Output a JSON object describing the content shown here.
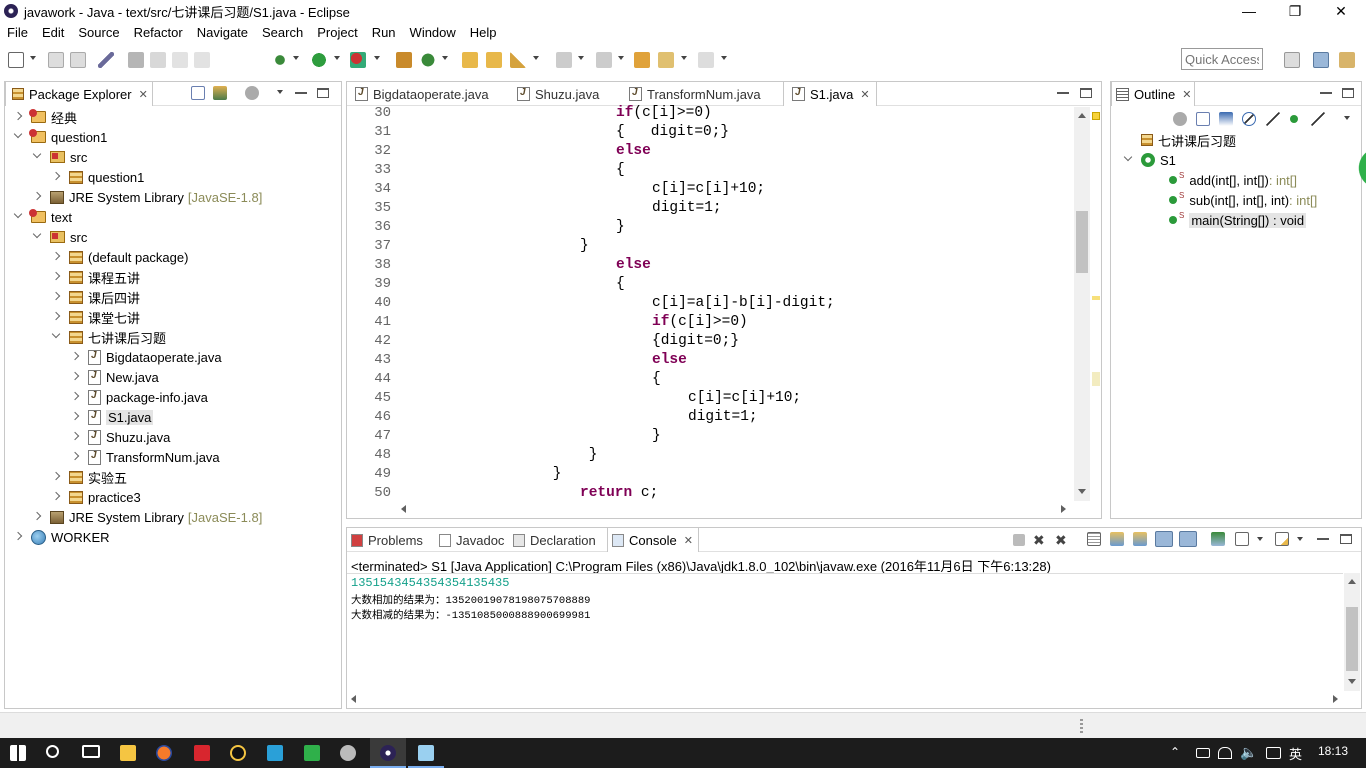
{
  "window": {
    "title": "javawork - Java - text/src/七讲课后习题/S1.java - Eclipse",
    "minimize_icon": "minimize-icon",
    "maximize_icon": "restore-icon",
    "close_icon": "close-icon"
  },
  "menu": [
    "File",
    "Edit",
    "Source",
    "Refactor",
    "Navigate",
    "Search",
    "Project",
    "Run",
    "Window",
    "Help"
  ],
  "toolbar": {
    "quick_access_placeholder": "Quick Access"
  },
  "package_explorer": {
    "tab_label": "Package Explorer",
    "tree": [
      {
        "label": "经典",
        "type": "proj",
        "expanded": false,
        "depth": 0
      },
      {
        "label": "question1",
        "type": "proj",
        "expanded": true,
        "depth": 0
      },
      {
        "label": "src",
        "type": "src",
        "expanded": true,
        "depth": 1
      },
      {
        "label": "question1",
        "type": "pkg",
        "expanded": false,
        "depth": 2
      },
      {
        "label": "JRE System Library",
        "suffix": "[JavaSE-1.8]",
        "type": "lib",
        "expanded": false,
        "depth": 1
      },
      {
        "label": "text",
        "type": "proj",
        "expanded": true,
        "depth": 0
      },
      {
        "label": "src",
        "type": "src",
        "expanded": true,
        "depth": 1
      },
      {
        "label": "(default package)",
        "type": "pkg",
        "expanded": false,
        "depth": 2
      },
      {
        "label": "课程五讲",
        "type": "pkg",
        "expanded": false,
        "depth": 2
      },
      {
        "label": "课后四讲",
        "type": "pkg",
        "expanded": false,
        "depth": 2
      },
      {
        "label": "课堂七讲",
        "type": "pkg",
        "expanded": false,
        "depth": 2
      },
      {
        "label": "七讲课后习题",
        "type": "pkg",
        "expanded": true,
        "depth": 2
      },
      {
        "label": "Bigdataoperate.java",
        "type": "java",
        "expanded": false,
        "depth": 3
      },
      {
        "label": "New.java",
        "type": "java",
        "expanded": false,
        "depth": 3
      },
      {
        "label": "package-info.java",
        "type": "java",
        "expanded": false,
        "depth": 3
      },
      {
        "label": "S1.java",
        "type": "java",
        "expanded": false,
        "depth": 3,
        "selected": true
      },
      {
        "label": "Shuzu.java",
        "type": "java",
        "expanded": false,
        "depth": 3
      },
      {
        "label": "TransformNum.java",
        "type": "java",
        "expanded": false,
        "depth": 3
      },
      {
        "label": "实验五",
        "type": "pkg",
        "expanded": false,
        "depth": 2
      },
      {
        "label": "practice3",
        "type": "pkg",
        "expanded": false,
        "depth": 2
      },
      {
        "label": "JRE System Library",
        "suffix": "[JavaSE-1.8]",
        "type": "lib",
        "expanded": false,
        "depth": 1
      },
      {
        "label": "WORKER",
        "type": "world",
        "expanded": false,
        "depth": 0
      }
    ]
  },
  "editor": {
    "tabs": [
      {
        "label": "Bigdataoperate.java",
        "active": false
      },
      {
        "label": "Shuzu.java",
        "active": false
      },
      {
        "label": "TransformNum.java",
        "active": false
      },
      {
        "label": "S1.java",
        "active": true
      }
    ],
    "lines": [
      {
        "n": "30",
        "indent": 24,
        "tokens": [
          {
            "t": "if",
            "k": true
          },
          {
            "t": "(c[i]>=0)"
          }
        ]
      },
      {
        "n": "31",
        "indent": 24,
        "tokens": [
          {
            "t": "{   digit=0;}"
          }
        ]
      },
      {
        "n": "32",
        "indent": 24,
        "tokens": [
          {
            "t": "else",
            "k": true
          }
        ]
      },
      {
        "n": "33",
        "indent": 24,
        "tokens": [
          {
            "t": "{"
          }
        ]
      },
      {
        "n": "34",
        "indent": 28,
        "tokens": [
          {
            "t": "c[i]=c[i]+10;"
          }
        ]
      },
      {
        "n": "35",
        "indent": 28,
        "tokens": [
          {
            "t": "digit=1;"
          }
        ]
      },
      {
        "n": "36",
        "indent": 24,
        "tokens": [
          {
            "t": "}"
          }
        ]
      },
      {
        "n": "37",
        "indent": 20,
        "tokens": [
          {
            "t": "}"
          }
        ]
      },
      {
        "n": "38",
        "indent": 24,
        "tokens": [
          {
            "t": "else",
            "k": true
          }
        ]
      },
      {
        "n": "39",
        "indent": 24,
        "tokens": [
          {
            "t": "{"
          }
        ]
      },
      {
        "n": "40",
        "indent": 28,
        "tokens": [
          {
            "t": "c[i]=a[i]-b[i]-digit;"
          }
        ]
      },
      {
        "n": "41",
        "indent": 28,
        "tokens": [
          {
            "t": "if",
            "k": true
          },
          {
            "t": "(c[i]>=0)"
          }
        ]
      },
      {
        "n": "42",
        "indent": 28,
        "tokens": [
          {
            "t": "{digit=0;}"
          }
        ]
      },
      {
        "n": "43",
        "indent": 28,
        "tokens": [
          {
            "t": "else",
            "k": true
          }
        ]
      },
      {
        "n": "44",
        "indent": 28,
        "tokens": [
          {
            "t": "{"
          }
        ]
      },
      {
        "n": "45",
        "indent": 32,
        "tokens": [
          {
            "t": "c[i]=c[i]+10;"
          }
        ]
      },
      {
        "n": "46",
        "indent": 32,
        "tokens": [
          {
            "t": "digit=1;"
          }
        ]
      },
      {
        "n": "47",
        "indent": 28,
        "tokens": [
          {
            "t": "}"
          }
        ]
      },
      {
        "n": "48",
        "indent": 20,
        "tokens": [
          {
            "t": " }"
          }
        ]
      },
      {
        "n": "49",
        "indent": 16,
        "tokens": [
          {
            "t": " }"
          }
        ]
      },
      {
        "n": "50",
        "indent": 20,
        "tokens": [
          {
            "t": "return",
            "k": true
          },
          {
            "t": " c;"
          }
        ]
      }
    ]
  },
  "outline": {
    "tab_label": "Outline",
    "items": [
      {
        "label": "七讲课后习题",
        "type": "pkg",
        "depth": 0
      },
      {
        "label": "S1",
        "type": "class",
        "depth": 0,
        "expanded": true
      },
      {
        "label": "add(int[], int[])",
        "ret": " : int[]",
        "type": "method",
        "depth": 1
      },
      {
        "label": "sub(int[], int[], int)",
        "ret": " : int[]",
        "type": "method",
        "depth": 1
      },
      {
        "label": "main(String[]) : void",
        "ret": "",
        "type": "main",
        "depth": 1,
        "selected": true
      }
    ]
  },
  "bottom": {
    "tabs": [
      {
        "label": "Problems",
        "active": false
      },
      {
        "label": "Javadoc",
        "active": false
      },
      {
        "label": "Declaration",
        "active": false
      },
      {
        "label": "Console",
        "active": true
      }
    ],
    "console_header": "<terminated> S1 [Java Application] C:\\Program Files (x86)\\Java\\jdk1.8.0_102\\bin\\javaw.exe (2016年11月6日 下午6:13:28)",
    "console_lines": [
      {
        "text": "1351543454354354135435",
        "color": "#13a08a",
        "size": 12
      },
      {
        "text": "大数相加的结果为：13520019078198075708889",
        "color": "#000000",
        "size": 10.5
      },
      {
        "text": "大数相减的结果为：-1351085000888900699981",
        "color": "#000000",
        "size": 10.5
      }
    ]
  },
  "taskbar": {
    "ime": "英",
    "clock": "18:13"
  },
  "colors": {
    "keyword": "#7f0055",
    "console_input": "#13a08a",
    "library_suffix": "#8b8b58"
  }
}
